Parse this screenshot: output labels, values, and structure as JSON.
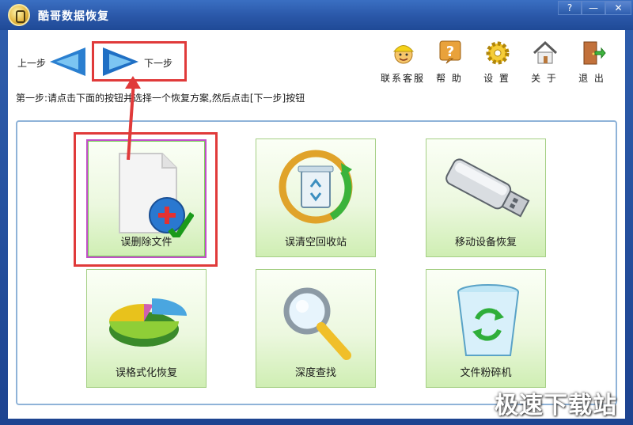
{
  "window": {
    "title": "酷哥数据恢复",
    "help_btn": "?",
    "min_btn": "—",
    "close_btn": "✕"
  },
  "nav": {
    "prev_label": "上一步",
    "next_label": "下一步"
  },
  "instruction": "第一步:请点击下面的按钮并选择一个恢复方案,然后点击[下一步]按钮",
  "toolbar": [
    {
      "label": "联系客服",
      "icon": "customer-service-icon"
    },
    {
      "label": "帮 助",
      "icon": "help-icon"
    },
    {
      "label": "设 置",
      "icon": "gear-icon"
    },
    {
      "label": "关 于",
      "icon": "home-icon"
    },
    {
      "label": "退 出",
      "icon": "exit-door-icon"
    }
  ],
  "tiles": [
    {
      "label": "误删除文件",
      "icon": "document-plus-icon",
      "selected": true
    },
    {
      "label": "误清空回收站",
      "icon": "recycle-bin-refresh-icon",
      "selected": false
    },
    {
      "label": "移动设备恢复",
      "icon": "usb-drive-icon",
      "selected": false
    },
    {
      "label": "误格式化恢复",
      "icon": "pie-chart-icon",
      "selected": false
    },
    {
      "label": "深度查找",
      "icon": "magnifier-icon",
      "selected": false
    },
    {
      "label": "文件粉碎机",
      "icon": "shred-bin-icon",
      "selected": false
    }
  ],
  "watermark": "极速下载站",
  "colors": {
    "titlebar": "#2a57a8",
    "tile_gradient_bottom": "#cfeeb3",
    "highlight_red": "#e03a3a",
    "selected_border": "#c24fc8"
  }
}
